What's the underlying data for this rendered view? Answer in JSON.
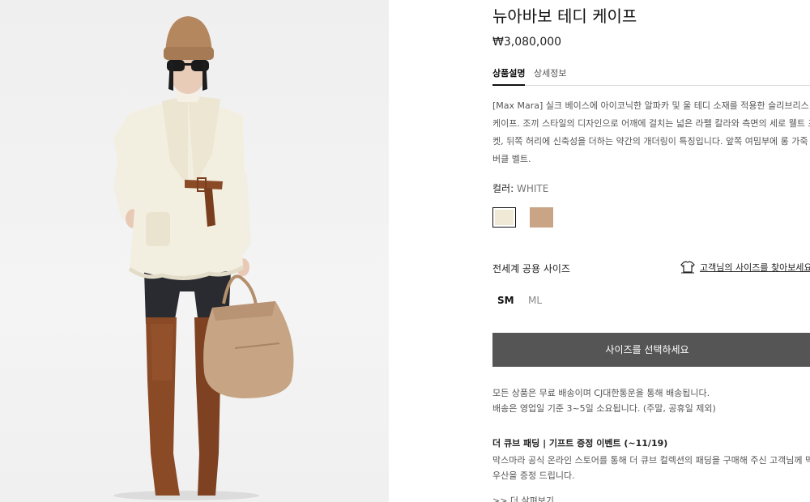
{
  "product": {
    "title": "뉴아바보 테디 케이프",
    "price": "₩3,080,000"
  },
  "tabs": [
    {
      "label": "상품설명",
      "active": true
    },
    {
      "label": "상세정보",
      "active": false
    }
  ],
  "description": "[Max Mara] 실크 베이스에 아이코닉한 알파카 및 울 테디 소재를 적용한 슬리브리스\n케이프. 조끼 스타일의 디자인으로 어깨에 걸치는 넓은 라펠 칼라와 측면의 세로 웰트 포\n켓, 뒤쪽 허리에 신축성을 더하는 약간의 개더링이 특징입니다. 앞쪽 여밈부에 롱 가죽\n버클 벨트.",
  "color": {
    "label": "컬러:",
    "value": "WHITE",
    "swatches": [
      {
        "name": "white",
        "hex": "#efe9d6",
        "selected": true
      },
      {
        "name": "camel",
        "hex": "#c9a586",
        "selected": false
      }
    ]
  },
  "size": {
    "label": "전세계 공용 사이즈",
    "guide_link": "고객님의 사이즈를 찾아보세요",
    "options": [
      "SM",
      "ML"
    ]
  },
  "cta_label": "사이즈를 선택하세요",
  "shipping": "모든 상품은 무료 배송이며 CJ대한통운을 통해 배송됩니다.\n배송은 영업일 기준 3~5일 소요됩니다. (주말, 공휴일 제외)",
  "event": {
    "title": "더 큐브 패딩 | 기프트 증정 이벤트 (~11/19)",
    "body": "막스마라 공식 온라인 스토어를 통해 더 큐브 컬렉션의 패딩을 구매해 주신 고객님께 막스마라\n우산을 증정 드립니다.",
    "more": ">> 더 살펴보기"
  },
  "icons": {
    "size_guide": "hanger-shirt-icon"
  }
}
